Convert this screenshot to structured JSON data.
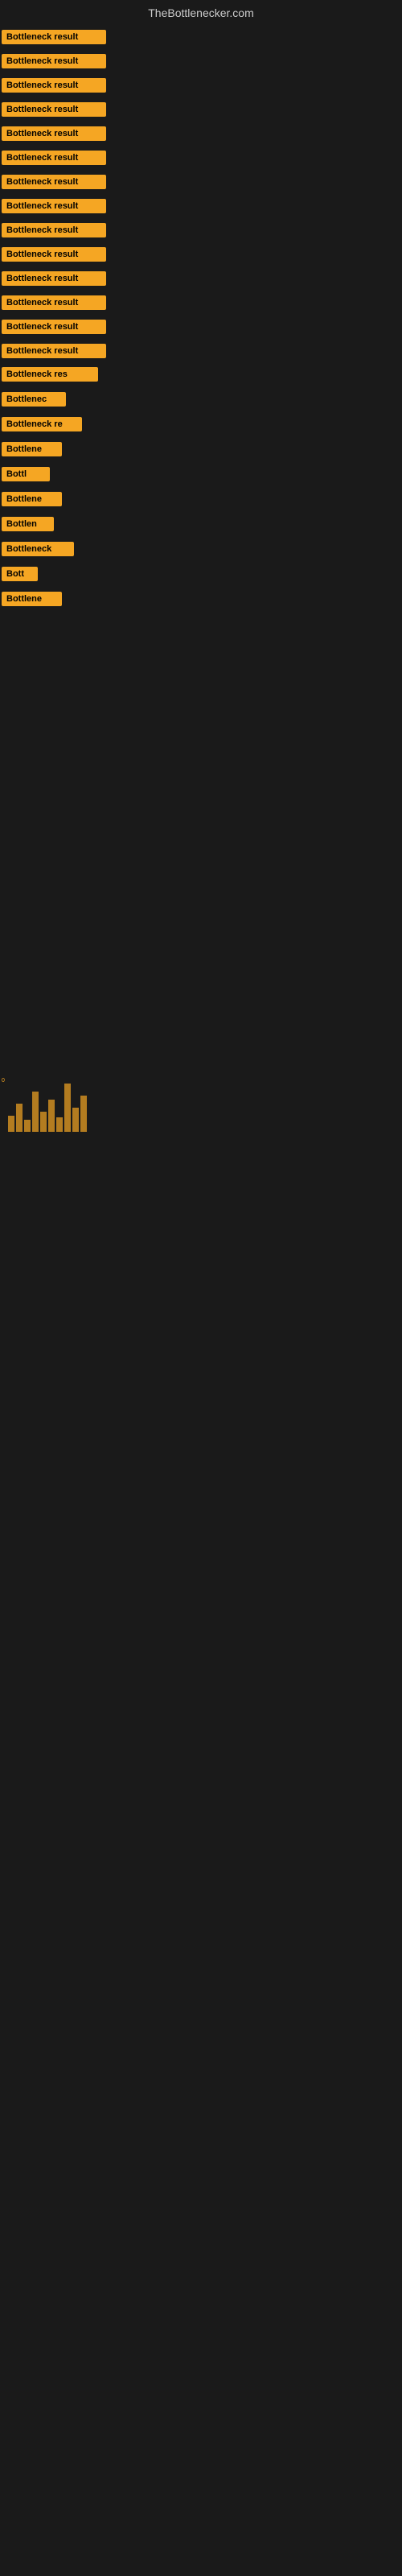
{
  "header": {
    "title": "TheBottlenecker.com"
  },
  "rows": [
    {
      "id": 1,
      "label": "Bottleneck result",
      "row_class": "row-1"
    },
    {
      "id": 2,
      "label": "Bottleneck result",
      "row_class": "row-2"
    },
    {
      "id": 3,
      "label": "Bottleneck result",
      "row_class": "row-3"
    },
    {
      "id": 4,
      "label": "Bottleneck result",
      "row_class": "row-4"
    },
    {
      "id": 5,
      "label": "Bottleneck result",
      "row_class": "row-5"
    },
    {
      "id": 6,
      "label": "Bottleneck result",
      "row_class": "row-6"
    },
    {
      "id": 7,
      "label": "Bottleneck result",
      "row_class": "row-7"
    },
    {
      "id": 8,
      "label": "Bottleneck result",
      "row_class": "row-8"
    },
    {
      "id": 9,
      "label": "Bottleneck result",
      "row_class": "row-9"
    },
    {
      "id": 10,
      "label": "Bottleneck result",
      "row_class": "row-10"
    },
    {
      "id": 11,
      "label": "Bottleneck result",
      "row_class": "row-11"
    },
    {
      "id": 12,
      "label": "Bottleneck result",
      "row_class": "row-12"
    },
    {
      "id": 13,
      "label": "Bottleneck result",
      "row_class": "row-13"
    },
    {
      "id": 14,
      "label": "Bottleneck result",
      "row_class": "row-14"
    },
    {
      "id": 15,
      "label": "Bottleneck res",
      "row_class": "row-15"
    },
    {
      "id": 16,
      "label": "Bottlenec",
      "row_class": "row-16"
    },
    {
      "id": 17,
      "label": "Bottleneck re",
      "row_class": "row-17"
    },
    {
      "id": 18,
      "label": "Bottlene",
      "row_class": "row-18"
    },
    {
      "id": 19,
      "label": "Bottl",
      "row_class": "row-19"
    },
    {
      "id": 20,
      "label": "Bottlene",
      "row_class": "row-20"
    },
    {
      "id": 21,
      "label": "Bottlen",
      "row_class": "row-21"
    },
    {
      "id": 22,
      "label": "Bottleneck",
      "row_class": "row-22"
    },
    {
      "id": 23,
      "label": "Bott",
      "row_class": "row-23"
    },
    {
      "id": 24,
      "label": "Bottlene",
      "row_class": "row-24"
    }
  ],
  "small_label": "0",
  "colors": {
    "background": "#1a1a1a",
    "label_bg": "#f5a623",
    "label_text": "#000000",
    "header_text": "#cccccc"
  }
}
